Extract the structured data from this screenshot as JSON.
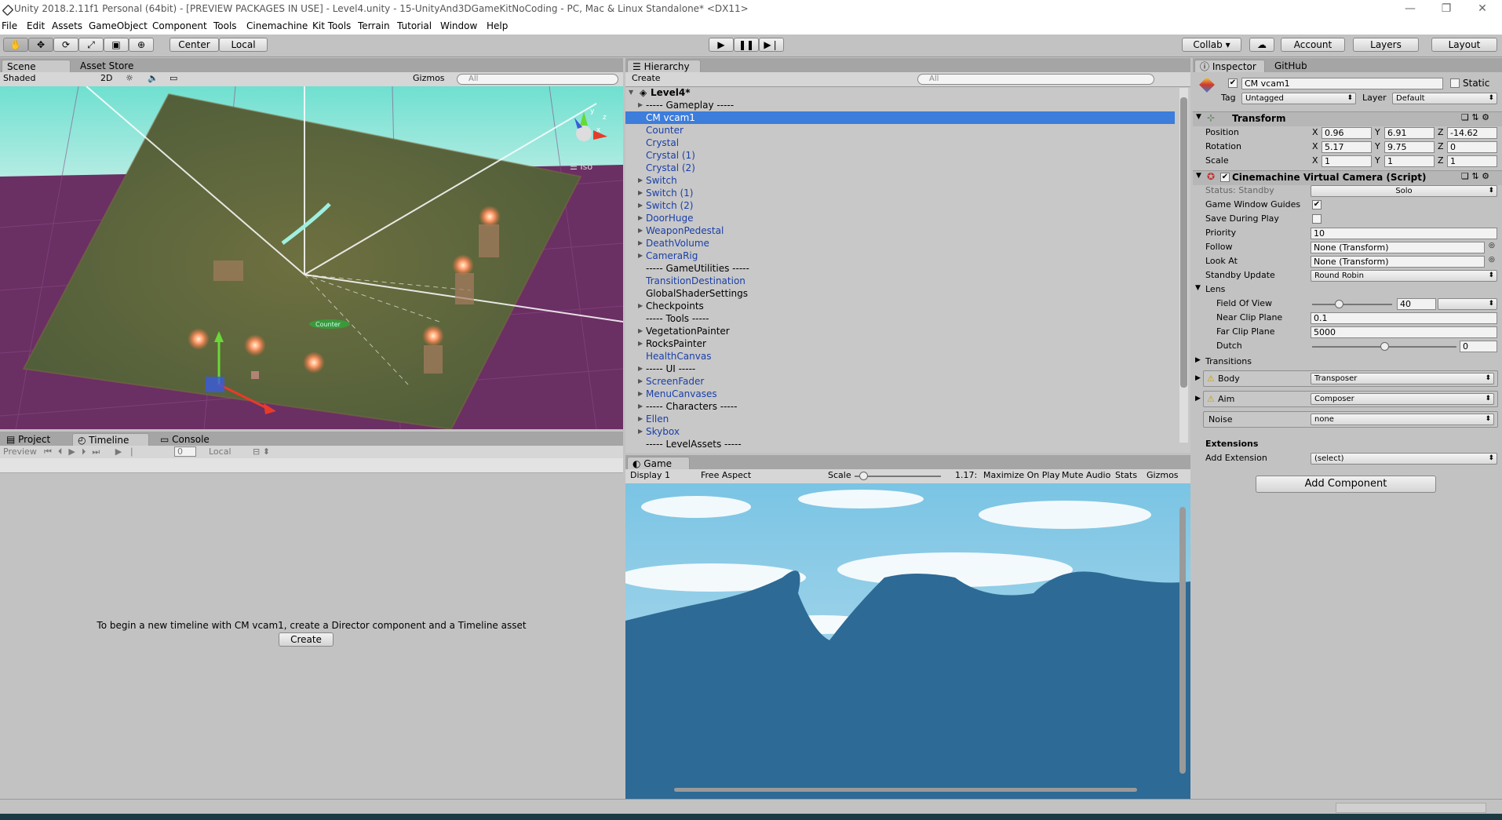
{
  "titlebar": {
    "title": "Unity 2018.2.11f1 Personal (64bit) - [PREVIEW PACKAGES IN USE] - Level4.unity - 15-UnityAnd3DGameKitNoCoding - PC, Mac & Linux Standalone* <DX11>",
    "minimize": "—",
    "restore": "❐",
    "close": "✕"
  },
  "menu": [
    "File",
    "Edit",
    "Assets",
    "GameObject",
    "Component",
    "Tools",
    "Cinemachine",
    "Kit Tools",
    "Terrain",
    "Tutorial",
    "Window",
    "Help"
  ],
  "toolbar": {
    "pivot": "Center",
    "space": "Local",
    "collab": "Collab ▾",
    "account": "Account",
    "layers": "Layers",
    "layout": "Layout"
  },
  "scene": {
    "tab_scene": "Scene",
    "tab_store": "Asset Store",
    "shading": "Shaded",
    "mode_2d": "2D",
    "gizmos": "Gizmos",
    "search": "All",
    "iso": "Iso",
    "label_counter": "Counter"
  },
  "hierarchy": {
    "tab": "Hierarchy",
    "create": "Create",
    "search": "All",
    "scene": "Level4*",
    "rows": [
      {
        "label": "----- Gameplay -----",
        "arrow": true,
        "blue": false
      },
      {
        "label": "CM vcam1",
        "arrow": false,
        "blue": false,
        "selected": true
      },
      {
        "label": "Counter",
        "arrow": false,
        "blue": true
      },
      {
        "label": "Crystal",
        "arrow": false,
        "blue": true
      },
      {
        "label": "Crystal (1)",
        "arrow": false,
        "blue": true
      },
      {
        "label": "Crystal (2)",
        "arrow": false,
        "blue": true
      },
      {
        "label": "Switch",
        "arrow": true,
        "blue": true
      },
      {
        "label": "Switch (1)",
        "arrow": true,
        "blue": true
      },
      {
        "label": "Switch (2)",
        "arrow": true,
        "blue": true
      },
      {
        "label": "DoorHuge",
        "arrow": true,
        "blue": true
      },
      {
        "label": "WeaponPedestal",
        "arrow": true,
        "blue": true
      },
      {
        "label": "DeathVolume",
        "arrow": true,
        "blue": true
      },
      {
        "label": "CameraRig",
        "arrow": true,
        "blue": true
      },
      {
        "label": "----- GameUtilities -----",
        "arrow": false,
        "blue": false
      },
      {
        "label": "TransitionDestination",
        "arrow": false,
        "blue": true
      },
      {
        "label": "GlobalShaderSettings",
        "arrow": false,
        "blue": false
      },
      {
        "label": "Checkpoints",
        "arrow": true,
        "blue": false
      },
      {
        "label": "----- Tools -----",
        "arrow": false,
        "blue": false
      },
      {
        "label": "VegetationPainter",
        "arrow": true,
        "blue": false
      },
      {
        "label": "RocksPainter",
        "arrow": true,
        "blue": false
      },
      {
        "label": "HealthCanvas",
        "arrow": false,
        "blue": true
      },
      {
        "label": "----- UI -----",
        "arrow": true,
        "blue": false
      },
      {
        "label": "ScreenFader",
        "arrow": true,
        "blue": true
      },
      {
        "label": "MenuCanvases",
        "arrow": true,
        "blue": true
      },
      {
        "label": "----- Characters -----",
        "arrow": true,
        "blue": false
      },
      {
        "label": "Ellen",
        "arrow": true,
        "blue": true
      },
      {
        "label": "Skybox",
        "arrow": true,
        "blue": true
      },
      {
        "label": "----- LevelAssets -----",
        "arrow": false,
        "blue": false
      }
    ]
  },
  "inspector": {
    "tab": "Inspector",
    "tab_github": "GitHub",
    "object_name": "CM vcam1",
    "static": "Static",
    "tag_label": "Tag",
    "tag": "Untagged",
    "layer_label": "Layer",
    "layer": "Default",
    "transform": {
      "title": "Transform",
      "position": "Position",
      "rotation": "Rotation",
      "scale": "Scale",
      "x": "X",
      "y": "Y",
      "z": "Z",
      "pos": [
        "0.96",
        "6.91",
        "-14.62"
      ],
      "rot": [
        "5.17",
        "9.75",
        "0"
      ],
      "scl": [
        "1",
        "1",
        "1"
      ]
    },
    "vcam": {
      "title": "Cinemachine Virtual Camera (Script)",
      "status": "Status: Standby",
      "solo": "Solo",
      "guides": "Game Window Guides",
      "save_play": "Save During Play",
      "priority_label": "Priority",
      "priority": "10",
      "follow_label": "Follow",
      "follow": "None (Transform)",
      "lookat_label": "Look At",
      "lookat": "None (Transform)",
      "standby_label": "Standby Update",
      "standby": "Round Robin",
      "lens": "Lens",
      "fov_label": "Field Of View",
      "fov": "40",
      "fov_norm": 0.33,
      "near_label": "Near Clip Plane",
      "near": "0.1",
      "far_label": "Far Clip Plane",
      "far": "5000",
      "dutch_label": "Dutch",
      "dutch": "0",
      "dutch_norm": 0.5,
      "transitions": "Transitions",
      "body_label": "Body",
      "body": "Transposer",
      "aim_label": "Aim",
      "aim": "Composer",
      "noise_label": "Noise",
      "noise": "none"
    },
    "extensions": "Extensions",
    "add_ext_label": "Add Extension",
    "add_ext": "(select)",
    "add_component": "Add Component"
  },
  "bottom": {
    "tab_project": "Project",
    "tab_timeline": "Timeline",
    "tab_console": "Console",
    "preview": "Preview",
    "frame": "0",
    "local": "Local",
    "message": "To begin a new timeline with CM vcam1, create a Director component and a Timeline asset",
    "create": "Create"
  },
  "game": {
    "tab": "Game",
    "display": "Display 1",
    "aspect": "Free Aspect",
    "scale_label": "Scale",
    "scale_value": "1.17:",
    "maximize": "Maximize On Play",
    "mute": "Mute Audio",
    "stats": "Stats",
    "gizmos": "Gizmos"
  }
}
